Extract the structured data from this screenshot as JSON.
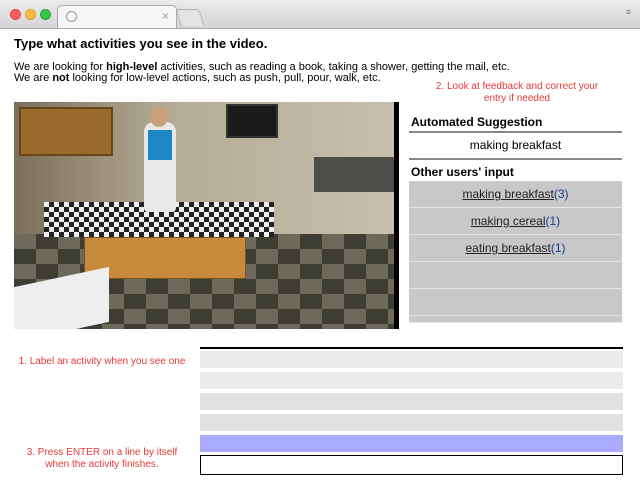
{
  "browser": {
    "tab_title": "",
    "tab_close": "×",
    "menu_dots": "≡"
  },
  "page": {
    "title": "Type what activities you see in the video.",
    "desc_line1": {
      "prefix": "We are looking for ",
      "bold": "high-level",
      "suffix": " activities, such as reading a book, taking a shower, getting the mail, etc."
    },
    "desc_line2": {
      "prefix": "We are ",
      "bold": "not",
      "suffix": " looking for low-level actions, such as push, pull, pour, walk, etc."
    }
  },
  "notes": {
    "step2": "2. Look at feedback and correct your entry if needed",
    "step1": "1. Label an activity when you see one",
    "step3": "3. Press ENTER on a line by itself when the activity finishes."
  },
  "suggestion": {
    "heading": "Automated Suggestion",
    "value": "making breakfast"
  },
  "other_inputs": {
    "heading": "Other users' input",
    "items": [
      {
        "label": "making breakfast",
        "count": "(3)"
      },
      {
        "label": "making cereal",
        "count": "(1)"
      },
      {
        "label": "eating breakfast",
        "count": "(1)"
      }
    ]
  },
  "entry": {
    "value": "",
    "placeholder": ""
  },
  "colors": {
    "note_red": "#e53935",
    "active_row": "#aaaaff",
    "panel_gray": "#c8c8c8"
  }
}
